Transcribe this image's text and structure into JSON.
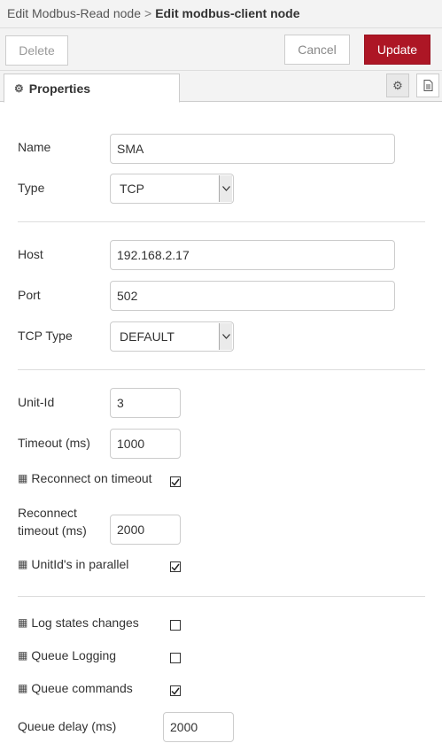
{
  "breadcrumb": {
    "parent": "Edit Modbus-Read node",
    "separator": ">",
    "current": "Edit modbus-client node"
  },
  "toolbar": {
    "delete_label": "Delete",
    "cancel_label": "Cancel",
    "update_label": "Update"
  },
  "colors": {
    "update_bg": "#ad1625",
    "header_bg": "#f3f3f3"
  },
  "tabs": {
    "properties_label": "Properties",
    "icons": [
      "gear-icon",
      "document-icon"
    ]
  },
  "form": {
    "name": {
      "label": "Name",
      "value": "SMA"
    },
    "type": {
      "label": "Type",
      "value": "TCP"
    },
    "host": {
      "label": "Host",
      "value": "192.168.2.17"
    },
    "port": {
      "label": "Port",
      "value": "502"
    },
    "tcp_type": {
      "label": "TCP Type",
      "value": "DEFAULT"
    },
    "unit_id": {
      "label": "Unit-Id",
      "value": "3"
    },
    "timeout": {
      "label": "Timeout (ms)",
      "value": "1000"
    },
    "reconnect_on_timeout": {
      "label": "Reconnect on timeout",
      "checked": true
    },
    "reconnect_timeout": {
      "label_line1": "Reconnect",
      "label_line2": "timeout (ms)",
      "value": "2000"
    },
    "unitids_parallel": {
      "label": "UnitId's in parallel",
      "checked": true
    },
    "log_state_changes": {
      "label": "Log states changes",
      "checked": false
    },
    "queue_logging": {
      "label": "Queue Logging",
      "checked": false
    },
    "queue_commands": {
      "label": "Queue commands",
      "checked": true
    },
    "queue_delay": {
      "label": "Queue delay (ms)",
      "value": "2000"
    }
  }
}
